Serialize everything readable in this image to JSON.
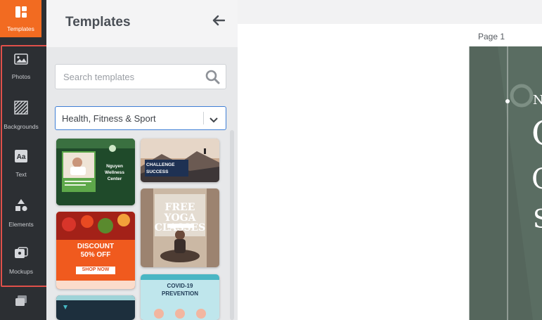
{
  "sidebar": {
    "active": {
      "label": "Templates",
      "icon": "templates-icon"
    },
    "items": [
      {
        "label": "Photos",
        "icon": "photos-icon"
      },
      {
        "label": "Backgrounds",
        "icon": "backgrounds-icon"
      },
      {
        "label": "Text",
        "icon": "text-icon"
      },
      {
        "label": "Elements",
        "icon": "elements-icon"
      },
      {
        "label": "Mockups",
        "icon": "mockups-icon"
      }
    ],
    "extra_icon": "layers-icon"
  },
  "panel": {
    "title": "Templates",
    "search_placeholder": "Search templates",
    "category": "Health, Fitness & Sport"
  },
  "templates": {
    "wellness": {
      "title": "Nguyen Wellness Center"
    },
    "challenge": {
      "title": "CHALLENGE SUCCESS"
    },
    "yoga": {
      "line1": "FREE",
      "line2": "YOGA",
      "line3": "CLASSES"
    },
    "discount": {
      "line1": "DISCOUNT",
      "line2": "50% OFF",
      "button": "SHOP NOW"
    },
    "covid": {
      "line1": "COVID-19",
      "line2": "PREVENTION"
    }
  },
  "canvas": {
    "page_label": "Page 1",
    "glyphs": [
      "N",
      "C",
      "C",
      "S"
    ]
  },
  "colors": {
    "accent": "#f26b21",
    "rail_bg": "#2c2f33",
    "focus": "#3f7fd6",
    "highlight": "#e0504a"
  }
}
